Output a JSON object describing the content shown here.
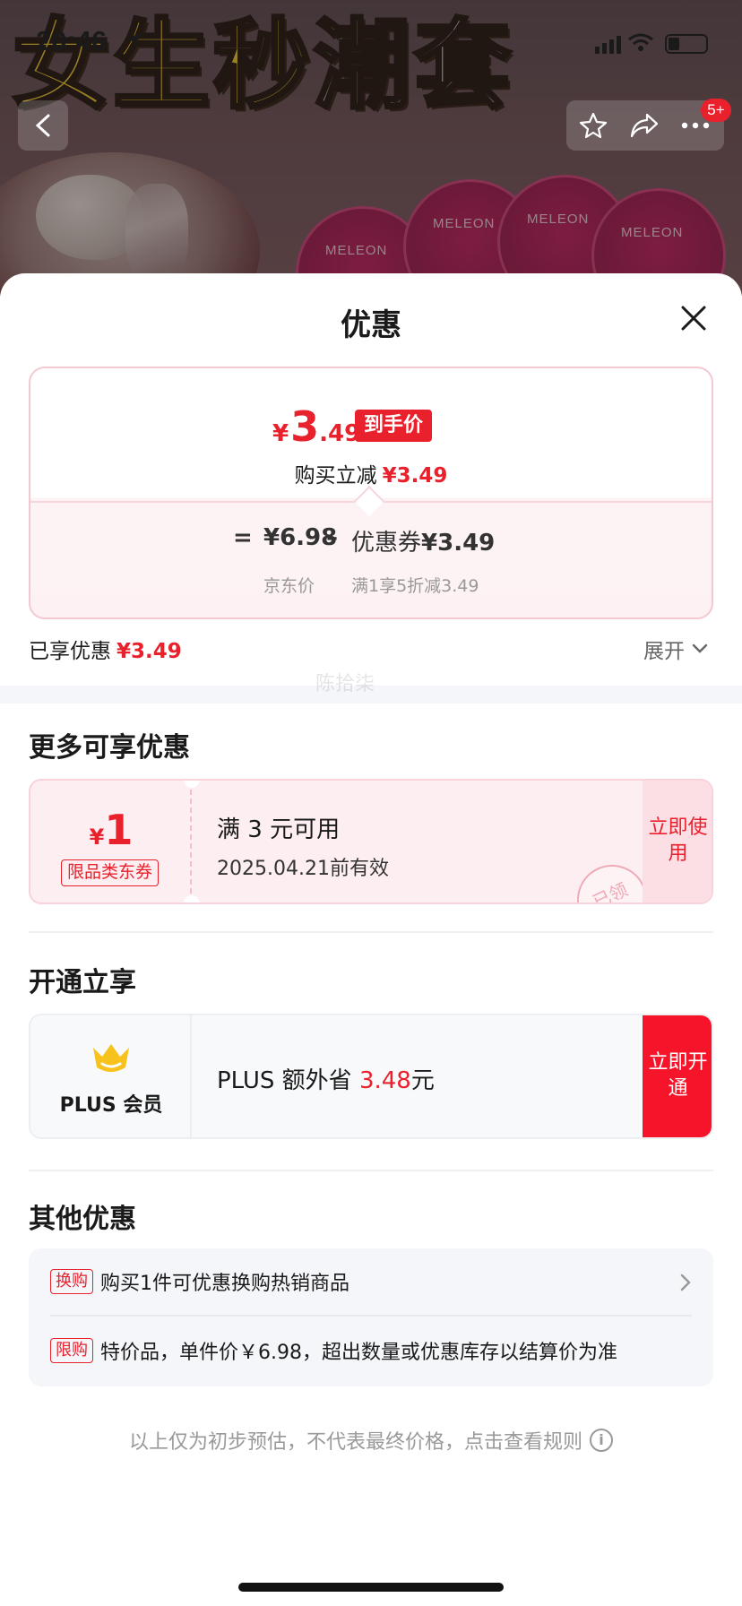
{
  "status": {
    "time": "20:46"
  },
  "nav": {
    "badge": "5+"
  },
  "banner": {
    "headline_part1": "女生秒",
    "headline_part2": "潮套",
    "brand": "MELEON"
  },
  "sheet": {
    "title": "优惠",
    "price_card": {
      "currency": "¥",
      "price_int": "3",
      "price_dec": ".49",
      "price_tag": "到手价",
      "reduce_label": "购买立减",
      "reduce_amount": "¥3.49",
      "equals": "=",
      "jd_price": "¥6.98",
      "minus": "–",
      "coupon_label": "优惠券",
      "coupon_amount": "¥3.49",
      "jd_price_label": "京东价",
      "coupon_desc": "满1享5折减3.49"
    },
    "enjoyed_label": "已享优惠",
    "enjoyed_amount": "¥3.49",
    "expand_label": "展开",
    "watermark": "陈拾柒",
    "more_title": "更多可享优惠",
    "coupon": {
      "currency": "¥",
      "amount": "1",
      "category": "限品类东券",
      "condition": "满 3 元可用",
      "validity": "2025.04.21前有效",
      "action": "立即使用",
      "stamp": "已领"
    },
    "open_title": "开通立享",
    "plus": {
      "name": "PLUS 会员",
      "save_prefix": "PLUS 额外省",
      "save_amount": "3.48",
      "save_suffix": "元",
      "action": "立即开通"
    },
    "other_title": "其他优惠",
    "others": [
      {
        "tag": "换购",
        "text": "购买1件可优惠换购热销商品"
      },
      {
        "tag": "限购",
        "text": "特价品，单件价￥6.98，超出数量或优惠库存以结算价为准"
      }
    ],
    "footnote": "以上仅为初步预估，不代表最终价格，点击查看规则"
  },
  "colors": {
    "accent": "#e8212d",
    "plus_button": "#f5142a",
    "coupon_bg": "#fdeef1"
  },
  "icons": [
    "location-arrow-icon",
    "back-icon",
    "star-icon",
    "share-icon",
    "more-icon",
    "close-icon",
    "chevron-down-icon",
    "crown-icon",
    "chevron-right-icon",
    "info-icon"
  ]
}
